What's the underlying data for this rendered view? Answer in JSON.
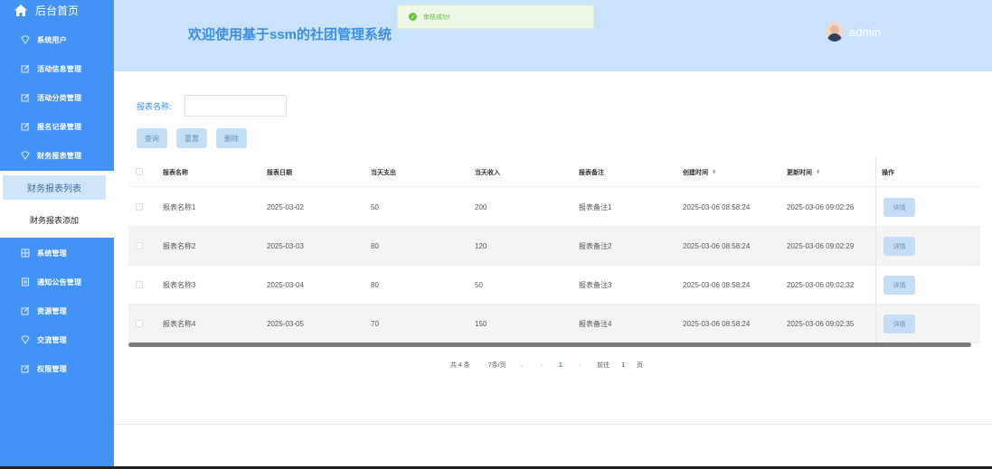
{
  "sidebar": {
    "home_label": "后台首页",
    "items": [
      {
        "label": "系统用户",
        "icon": "diamond-icon"
      },
      {
        "label": "活动信息管理",
        "icon": "edit-icon"
      },
      {
        "label": "活动分类管理",
        "icon": "edit-icon"
      },
      {
        "label": "报名记录管理",
        "icon": "edit-icon"
      },
      {
        "label": "财务报表管理",
        "icon": "diamond-icon"
      },
      {
        "label": "系统管理",
        "icon": "grid-icon"
      },
      {
        "label": "通知公告管理",
        "icon": "doc-icon"
      },
      {
        "label": "资源管理",
        "icon": "edit-icon"
      },
      {
        "label": "交流管理",
        "icon": "diamond-icon"
      },
      {
        "label": "权限管理",
        "icon": "edit-icon"
      }
    ],
    "submenu": {
      "active": "财务报表列表",
      "other": "财务报表添加"
    }
  },
  "header": {
    "title": "欢迎使用基于ssm的社团管理系统",
    "username": "admin"
  },
  "toast": {
    "text": "审核成功!"
  },
  "search": {
    "label": "报表名称:",
    "value": "",
    "placeholder": ""
  },
  "buttons": {
    "query": "查询",
    "reset": "重置",
    "delete": "删除"
  },
  "table": {
    "columns": [
      "报表名称",
      "报表日期",
      "当天支出",
      "当天收入",
      "报表备注",
      "创建时间",
      "更新时间",
      "操作"
    ],
    "rows": [
      {
        "name": "报表名称1",
        "date": "2025-03-02",
        "expense": "50",
        "income": "200",
        "remark": "报表备注1",
        "created": "2025-03-06 08:58:24",
        "updated": "2025-03-06 09:02:26",
        "action": "详情"
      },
      {
        "name": "报表名称2",
        "date": "2025-03-03",
        "expense": "80",
        "income": "120",
        "remark": "报表备注2",
        "created": "2025-03-06 08:58:24",
        "updated": "2025-03-06 09:02:29",
        "action": "详情"
      },
      {
        "name": "报表名称3",
        "date": "2025-03-04",
        "expense": "80",
        "income": "50",
        "remark": "报表备注3",
        "created": "2025-03-06 08:58:24",
        "updated": "2025-03-06 09:02:32",
        "action": "详情"
      },
      {
        "name": "报表名称4",
        "date": "2025-03-05",
        "expense": "70",
        "income": "150",
        "remark": "报表备注4",
        "created": "2025-03-06 08:58:24",
        "updated": "2025-03-06 09:02:35",
        "action": "详情"
      }
    ]
  },
  "pagination": {
    "total": "共 4 条",
    "page_size": "7条/页",
    "current": "1",
    "goto_label": "前往",
    "goto_value": "1",
    "page_unit": "页"
  },
  "colors": {
    "sidebar": "#4393f7",
    "header": "#c8e3fb",
    "accent": "#3a8ee8",
    "button": "#c4def8"
  }
}
